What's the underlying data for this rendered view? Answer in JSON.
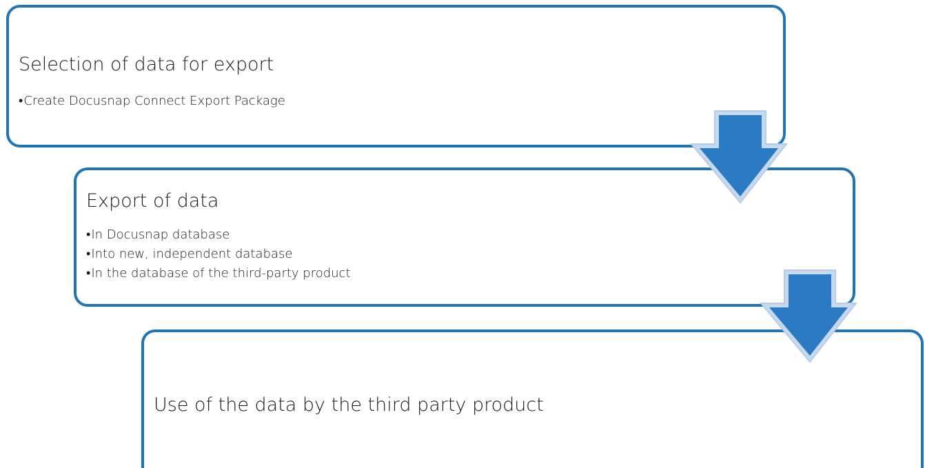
{
  "steps": [
    {
      "title": "Selection of data for export",
      "bullets": [
        "Create Docusnap Connect Export Package"
      ]
    },
    {
      "title": "Export of data",
      "bullets": [
        "In Docusnap database",
        "Into new, independent database",
        "In the database of the third-party product"
      ]
    },
    {
      "title": "Use of the data by the third party product",
      "bullets": []
    }
  ],
  "colors": {
    "border": "#1f73b7",
    "arrow_fill": "#2a7ac4",
    "arrow_outline": "#c6d9ee"
  },
  "icons": [
    "down-arrow-icon",
    "down-arrow-icon"
  ]
}
